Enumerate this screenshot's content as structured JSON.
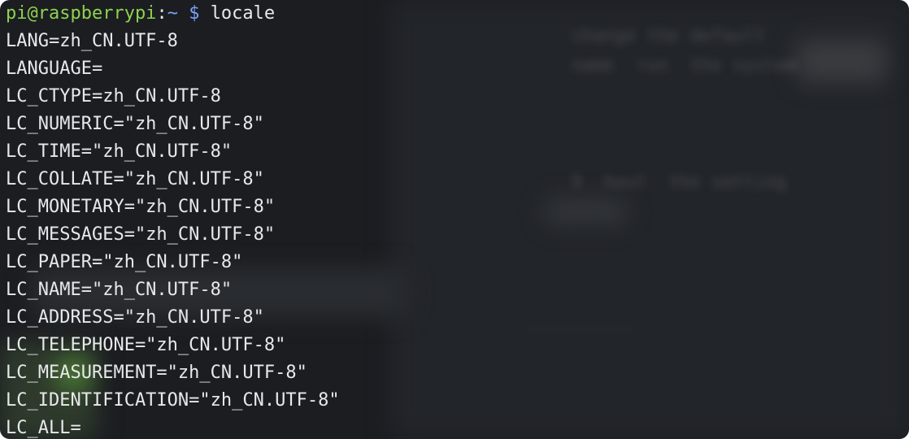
{
  "prompt": {
    "user_host": "pi@raspberrypi",
    "separator": ":",
    "path": "~",
    "symbol": "$",
    "command": "locale"
  },
  "output_lines": [
    "LANG=zh_CN.UTF-8",
    "LANGUAGE=",
    "LC_CTYPE=zh_CN.UTF-8",
    "LC_NUMERIC=\"zh_CN.UTF-8\"",
    "LC_TIME=\"zh_CN.UTF-8\"",
    "LC_COLLATE=\"zh_CN.UTF-8\"",
    "LC_MONETARY=\"zh_CN.UTF-8\"",
    "LC_MESSAGES=\"zh_CN.UTF-8\"",
    "LC_PAPER=\"zh_CN.UTF-8\"",
    "LC_NAME=\"zh_CN.UTF-8\"",
    "LC_ADDRESS=\"zh_CN.UTF-8\"",
    "LC_TELEPHONE=\"zh_CN.UTF-8\"",
    "LC_MEASUREMENT=\"zh_CN.UTF-8\"",
    "LC_IDENTIFICATION=\"zh_CN.UTF-8\"",
    "LC_ALL="
  ],
  "colors": {
    "background": "#1b1d21",
    "prompt_user": "#8fd14f",
    "prompt_path": "#7aa2f7",
    "text": "#e8e8ea"
  }
}
